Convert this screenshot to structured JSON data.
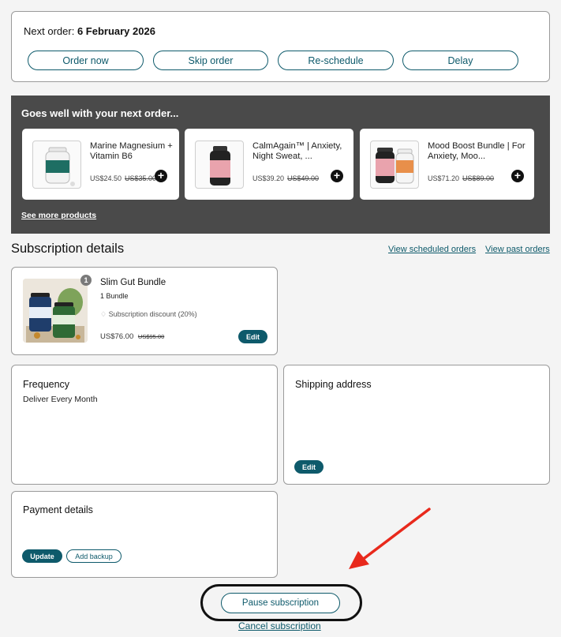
{
  "next_order": {
    "label": "Next order:",
    "date": "6 February 2026",
    "actions": [
      "Order now",
      "Skip order",
      "Re-schedule",
      "Delay"
    ]
  },
  "upsell": {
    "title": "Goes well with your next order...",
    "products": [
      {
        "name": "Marine Magnesium + Vitamin B6",
        "price": "US$24.50",
        "old_price": "US$35.00"
      },
      {
        "name": "CalmAgain™ | Anxiety, Night Sweat, ...",
        "price": "US$39.20",
        "old_price": "US$49.00"
      },
      {
        "name": "Mood Boost Bundle | For Anxiety, Moo...",
        "price": "US$71.20",
        "old_price": "US$89.00"
      }
    ],
    "see_more": "See more products"
  },
  "subscription": {
    "title": "Subscription details",
    "view_scheduled": "View scheduled orders",
    "view_past": "View past orders",
    "item": {
      "qty_badge": "1",
      "name": "Slim Gut Bundle",
      "variant": "1 Bundle",
      "discount": "Subscription discount (20%)",
      "price": "US$76.00",
      "old_price": "US$95.00",
      "edit": "Edit"
    },
    "frequency": {
      "title": "Frequency",
      "value": "Deliver Every Month"
    },
    "shipping": {
      "title": "Shipping address",
      "edit": "Edit"
    },
    "payment": {
      "title": "Payment details",
      "update": "Update",
      "add_backup": "Add backup"
    },
    "pause": "Pause subscription",
    "cancel": "Cancel subscription"
  },
  "colors": {
    "accent": "#0e5a6b",
    "dark_panel": "#4a4a4a",
    "annotation": "#e8291c"
  }
}
